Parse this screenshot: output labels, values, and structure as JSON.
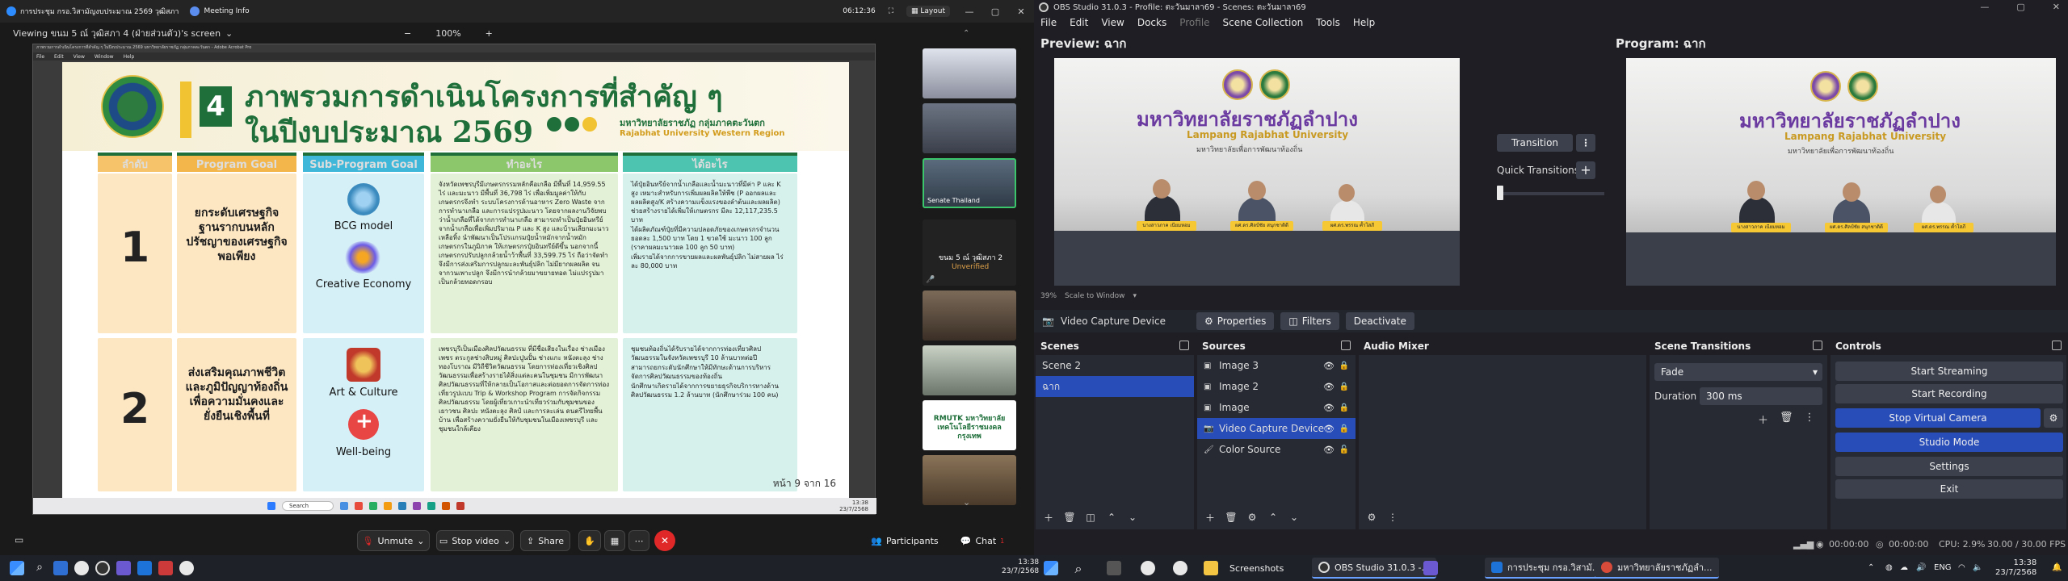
{
  "zoom": {
    "tab1": "การประชุม กรอ.วิสามัญงบประมาณ 2569 วุฒิสภา",
    "tab2": "Meeting Info",
    "time": "06:12:36",
    "layout_label": "Layout",
    "viewing_label": "Viewing ขนม 5 ณ์ วุฒิสภา 4 (ฝ่ายส่วนตัว)'s screen",
    "zoom_level": "100%",
    "acrobat_title": "ภาพรวมการดำเนินโครงการที่สำคัญ ๆ ในปีงบประมาณ 2569 มหาวิทยาลัยราชภัฏ กลุ่มภาคตะวันตก - Adobe Acrobat Pro",
    "acrobat_menu": [
      "File",
      "Edit",
      "View",
      "Window",
      "Help"
    ],
    "slide": {
      "number_badge": "4",
      "title_line1": "ภาพรวมการดำเนินโครงการที่สำคัญ ๆ",
      "title_line2": "ในปีงบประมาณ 2569",
      "uni_th": "มหาวิทยาลัยราชภัฏ กลุ่มภาคตะวันตก",
      "uni_en": "Rajabhat University Western Region",
      "headers": [
        "ลำดับ",
        "Program Goal",
        "Sub-Program Goal",
        "ทำอะไร",
        "ได้อะไร"
      ],
      "rows": [
        {
          "num": "1",
          "goal": "ยกระดับเศรษฐกิจฐานรากบนหลักปรัชญาของเศรษฐกิจพอเพียง",
          "sub1": "BCG model",
          "sub2": "Creative Economy",
          "what": "จังหวัดเพชรบุรีมีเกษตรกรรมหลักคือเกลือ มีพื้นที่ 14,959.55 ไร่ และมะนาว มีพื้นที่ 36,798 ไร่ เพื่อเพิ่มมูลค่าให้กับเกษตรกรจึงทำ ระบบโครงการด้านอาหาร Zero Waste จากการทำนาเกลือ และการแปรรูปมะนาว โดยจากผลงานวิจัยพบว่าน้ำเกลือที่ได้จากการทำนาเกลือ สามารถทำเป็นปุ๋ยอินทรีย์จากน้ำเกลือเพื่อเพิ่มปริมาณ P และ K สูง และบ้านเลียกมะนาวเหลือทิ้ง นำพัฒนาเป็นโปรแกรมปุ๋ยน้ำหมักจากน้ำหมักเกษตรกรในภูมิภาค ให้เกษตรกรปุ๋ยอินทรีย์ดีขึ้น นอกจากนี้ เกษตรกรปรับปลูกกล้วยน้ำว้าพื้นที่ 33,599.75 ไร่ ถือว่าจัดทำ จึงมีการส่งเสริมการปลูกมะละพันธุ์ปลิก ไม่มียากผลผลิต จนจากวนเพาะปลูก จึงมีการนำกล้วยมาขยายทอด ไม่แปรรูปมาเป็นกล้วยทอดกรอบ",
          "get": [
            "ได้ปุ๋ยอินทรีย์จากน้ำเกลือและน้ำมะนาวที่มีค่า P และ K สูง เหมาะสำหรับการเพิ่มผลผลิตให้พืช (P ออกผลและผลผลิตสูง/K สร้างความแข็งแรงของลำต้นและผลผลิต) ช่วยสร้างรายได้เพิ่มให้เกษตรกร มีละ 12,117,235.5 บาท",
            "ได้ผลิตภัณฑ์ปุ๋ยที่มีความปลอดภัยของเกษตรกรจำนวน ยอดละ 1,500 บาท โดย 1 ขวดใช้ มะนาว 100 ลูก (ราคาผลมะนาวผล 100 ลูก 50 บาท)",
            "เพิ่มรายได้จากการขายผลและผลพันธุ์ปลิก ไม่สายผล ไร่ละ 80,000 บาท"
          ]
        },
        {
          "num": "2",
          "goal": "ส่งเสริมคุณภาพชีวิตและภูมิปัญญาท้องถิ่นเพื่อความมั่นคงและยั่งยืนเชิงพื้นที่",
          "sub1": "Art & Culture",
          "sub2": "Well-being",
          "what": "เพชรบุรีเป็นเมืองศิลปวัฒนธรรม ที่มีชื่อเสียงในเรื่อง ช่างเมืองเพชร ตระกูลช่างสิบหมู่ ศิลปะปูนปั้น ช่างแกะ หนังตะลุง ช่างทองโบราณ มีวิถีชีวิตวัฒนธรรม โดยการท่องเที่ยวเชิงศิลปวัฒนธรรมเพื่อสร้างรายได้สิ่งแต่ละคนในชุมชน มีการพัฒนาศิลปวัฒนธรรมที่ให้กลายเป็นโอกาสและต่อยอดการจัดการท่องเที่ยวรูปแบบ Trip & Workshop Program การจัดกิจกรรมศิลปวัฒนธรรม โดยผู้เที่ยวเกาะนำเที่ยวร่วมกับชุมชนของเยาวชน ศิลปะ หนังตะลุง ศิลป์ และการละเล่น ดนตรีไทยพื้นบ้าน เพื่อสร้างความยั่งยืนให้กับชุมชนในเมืองเพชรบุรี และชุมชนใกล้เคียง",
          "get": [
            "ชุมชนท้องถิ่นได้รับรายได้จากการท่องเที่ยวศิลปวัฒนธรรมในจังหวัดเพชรบุรี 10 ล้านบาทต่อปี",
            "สามารถยกระดับนักศึกษาให้มีทักษะด้านการบริหารจัดการศิลปวัฒนธรรมของท้องถิ่น",
            "นักศึกษาเกิดรายได้จากการขยายธุรกิจบริการทางด้านศิลปวัฒนธรรม 1.2 ล้านบาท (นักศึกษาร่วม 100 คน)"
          ]
        }
      ],
      "page": "หน้า 9 จาก 16"
    },
    "inner_taskbar_search": "Search",
    "inner_time": "13:38",
    "inner_date": "23/7/2568",
    "thumbs": [
      {
        "label": ""
      },
      {
        "label": ""
      },
      {
        "label": "Senate Thailand"
      },
      {
        "label": "ขนม 5 ณ์ วุฒิสภา 2",
        "sub": "Unverified"
      },
      {
        "label": ""
      },
      {
        "label": ""
      },
      {
        "label": "RMUTK มหาวิทยาลัยเทคโนโลยีราชมงคลกรุงเทพ"
      },
      {
        "label": ""
      }
    ],
    "controls": {
      "unmute": "Unmute",
      "stop_video": "Stop video",
      "share": "Share",
      "participants": "Participants",
      "chat": "Chat",
      "chat_badge": "1"
    }
  },
  "obs": {
    "title": "OBS Studio 31.0.3 - Profile: ตะวันมาลา69 - Scenes: ตะวันมาลา69",
    "menu": [
      "File",
      "Edit",
      "View",
      "Docks",
      "Profile",
      "Scene Collection",
      "Tools",
      "Help"
    ],
    "preview_label": "Preview: ฉาก",
    "program_label": "Program: ฉาก",
    "stage": {
      "th": "มหาวิทยาลัยราชภัฏลำปาง",
      "en": "Lampang Rajabhat University",
      "sub": "มหาวิทยาลัยเพื่อการพัฒนาท้องถิ่น",
      "names": [
        "นางสาวภาค เนียมหอม",
        "ผศ.ดร.ศิลป์ชัย สนุกชาติดี",
        "ผศ.ดร.พรรณ ค้ำโสภี"
      ]
    },
    "transition_btn": "Transition",
    "quick_transitions": "Quick Transitions",
    "scale_info": "39%",
    "scale_label": "Scale to Window",
    "context": {
      "source": "Video Capture Device",
      "properties": "Properties",
      "filters": "Filters",
      "deactivate": "Deactivate"
    },
    "scenes": {
      "title": "Scenes",
      "items": [
        "Scene 2",
        "ฉาก"
      ]
    },
    "sources": {
      "title": "Sources",
      "items": [
        "Image 3",
        "Image 2",
        "Image",
        "Video Capture Device",
        "Color Source"
      ]
    },
    "mixer": {
      "title": "Audio Mixer"
    },
    "transitions": {
      "title": "Scene Transitions",
      "selected": "Fade",
      "duration_label": "Duration",
      "duration_value": "300 ms"
    },
    "controls": {
      "title": "Controls",
      "items": [
        "Start Streaming",
        "Start Recording",
        "Stop Virtual Camera",
        "Studio Mode",
        "Settings",
        "Exit"
      ]
    },
    "status": {
      "rec": "00:00:00",
      "stream": "00:00:00",
      "cpu": "CPU: 2.9%",
      "fps": "30.00 / 30.00 FPS"
    }
  },
  "taskbar": {
    "apps": [
      {
        "label": "Screenshots"
      },
      {
        "label": "OBS Studio 31.0.3 -..."
      },
      {
        "label": "การประชุม กรอ.วิสามั..."
      },
      {
        "label": "มหาวิทยาลัยราชภัฏลำ..."
      }
    ],
    "lang": "ENG",
    "time": "13:38",
    "date": "23/7/2568"
  }
}
